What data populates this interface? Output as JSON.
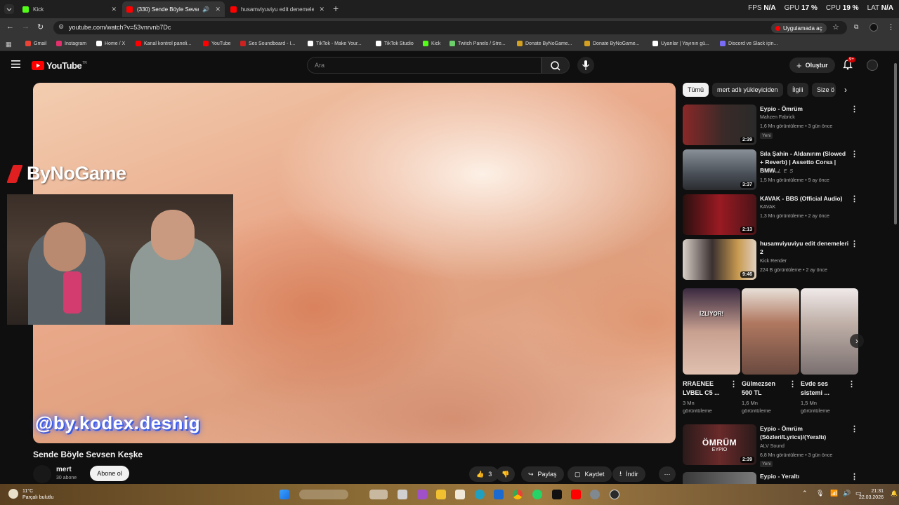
{
  "browser": {
    "tabs": [
      {
        "title": "Kick",
        "color": "#53fc18"
      },
      {
        "title": "(330) Sende Böyle Sevsen K",
        "color": "#ff0000"
      },
      {
        "title": "husamviyuviyu edit denemeleri",
        "color": "#ff0000"
      }
    ],
    "perf": {
      "fps_label": "FPS",
      "fps": "N/A",
      "gpu_label": "GPU",
      "gpu": "17 %",
      "cpu_label": "CPU",
      "cpu": "19 %",
      "lat_label": "LAT",
      "lat": "N/A"
    },
    "url": "youtube.com/watch?v=53vnrvnb7Dc",
    "open_in_app": "Uygulamada aç",
    "bookmarks": [
      {
        "label": "Gmail",
        "color": "#ea4335"
      },
      {
        "label": "Instagram",
        "color": "#e1306c"
      },
      {
        "label": "Home / X",
        "color": "#ffffff"
      },
      {
        "label": "Kanal kontrol paneli...",
        "color": "#ff0000"
      },
      {
        "label": "YouTube",
        "color": "#ff0000"
      },
      {
        "label": "Ses Soundboard - I...",
        "color": "#cc2222"
      },
      {
        "label": "TikTok - Make Your...",
        "color": "#ffffff"
      },
      {
        "label": "TikTok Studio",
        "color": "#ffffff"
      },
      {
        "label": "Kick",
        "color": "#53fc18"
      },
      {
        "label": "Twitch Panels / Stre...",
        "color": "#6ccf6c"
      },
      {
        "label": "Donate ByNoGame...",
        "color": "#d4a020"
      },
      {
        "label": "Donate ByNoGame...",
        "color": "#d4a020"
      },
      {
        "label": "Uyarılar | Yayının gü...",
        "color": "#ffffff"
      },
      {
        "label": "Discord ve Slack için...",
        "color": "#7b6cf6"
      }
    ]
  },
  "youtube": {
    "logo_text": "YouTube",
    "logo_region": "TR",
    "search_placeholder": "Ara",
    "create_label": "Oluştur",
    "notif_count": "9+"
  },
  "video": {
    "overlay_brand": "ByNoGame",
    "watermark": "@by.kodex.desnig",
    "title": "Sende Böyle Sevsen Keşke",
    "channel": "mert",
    "subs": "30 abone",
    "subscribe": "Abone ol",
    "likes": "3",
    "share": "Paylaş",
    "save": "Kaydet",
    "download": "İndir"
  },
  "chips": [
    "Tümü",
    "mert adlı yükleyiciden",
    "İlgili",
    "Size ö"
  ],
  "recommendations": [
    {
      "title": "Eypio - Ömrüm",
      "channel": "Mahzen Fabrick",
      "meta": "1,6 Mn görüntüleme • 3 gün önce",
      "badge": "Yeni",
      "duration": "2:39",
      "thumb": "#7a3030"
    },
    {
      "title": "Sıla Şahin - Aldanırım (Slowed + Reverb) | Assetto Corsa | BMW...",
      "channel": "C H A L E S",
      "meta": "1,5 Mn görüntüleme • 9 ay önce",
      "badge": "",
      "duration": "3:37",
      "thumb": "#6a7078"
    },
    {
      "title": "KAVAK - BBS (Official Audio)",
      "channel": "KAVAK",
      "meta": "1,3 Mn görüntüleme • 2 ay önce",
      "badge": "",
      "duration": "2:13",
      "thumb": "#8a1820"
    },
    {
      "title": "husamviyuviyu edit denemeleri 2",
      "channel": "Kick Render",
      "meta": "224 B görüntüleme • 2 ay önce",
      "badge": "",
      "duration": "9:46",
      "thumb": "#9a8a70"
    }
  ],
  "shorts": [
    {
      "title": "RRAENEE LVBEL C5 ...",
      "views": "3 Mn",
      "views_label": "görüntüleme",
      "tag": "İZLİYOR!",
      "thumb": "#6a5048"
    },
    {
      "title": "Gülmezsen 500 TL",
      "views": "1,6 Mn",
      "views_label": "görüntüleme",
      "tag": "",
      "thumb": "#8a6050"
    },
    {
      "title": "Evde ses sistemi ...",
      "views": "1,5 Mn",
      "views_label": "görüntüleme",
      "tag": "",
      "thumb": "#b0a8a0"
    }
  ],
  "recommendations2": [
    {
      "title": "Eypio - Ömrüm (Sözleri/Lyrics)/(Yeraltı)",
      "channel": "ALV Sound",
      "meta": "6,8 Mn görüntüleme • 3 gün önce",
      "badge": "Yeni",
      "duration": "2:39",
      "thumb": "#5a2a2a",
      "thumb_text": "ÖMRÜM",
      "thumb_sub": "EYPIO"
    },
    {
      "title": "Eypio - Yeraltı",
      "channel": "",
      "meta": "",
      "badge": "",
      "duration": "",
      "thumb": "#4a4a4a",
      "thumb_text": "",
      "thumb_sub": ""
    }
  ],
  "taskbar": {
    "temp": "11°C",
    "weather": "Parçalı bulutlu",
    "time": "21:31",
    "date": "22.03.2026"
  }
}
